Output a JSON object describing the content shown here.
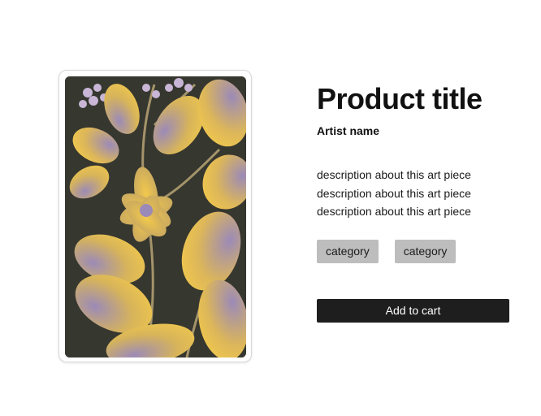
{
  "product": {
    "title": "Product title",
    "artist": "Artist name",
    "description_lines": [
      "description about this art piece",
      "description about this art piece",
      "description about this art piece"
    ],
    "categories": [
      "category",
      "category"
    ],
    "add_to_cart_label": "Add to cart"
  },
  "artwork": {
    "icon": "floral-artwork",
    "colors": {
      "background": "#36372f",
      "yellow": "#f2c94c",
      "purple": "#9b8ab8"
    }
  },
  "colors": {
    "button_bg": "#1e1e1e",
    "tag_bg": "#bdbdbd"
  }
}
